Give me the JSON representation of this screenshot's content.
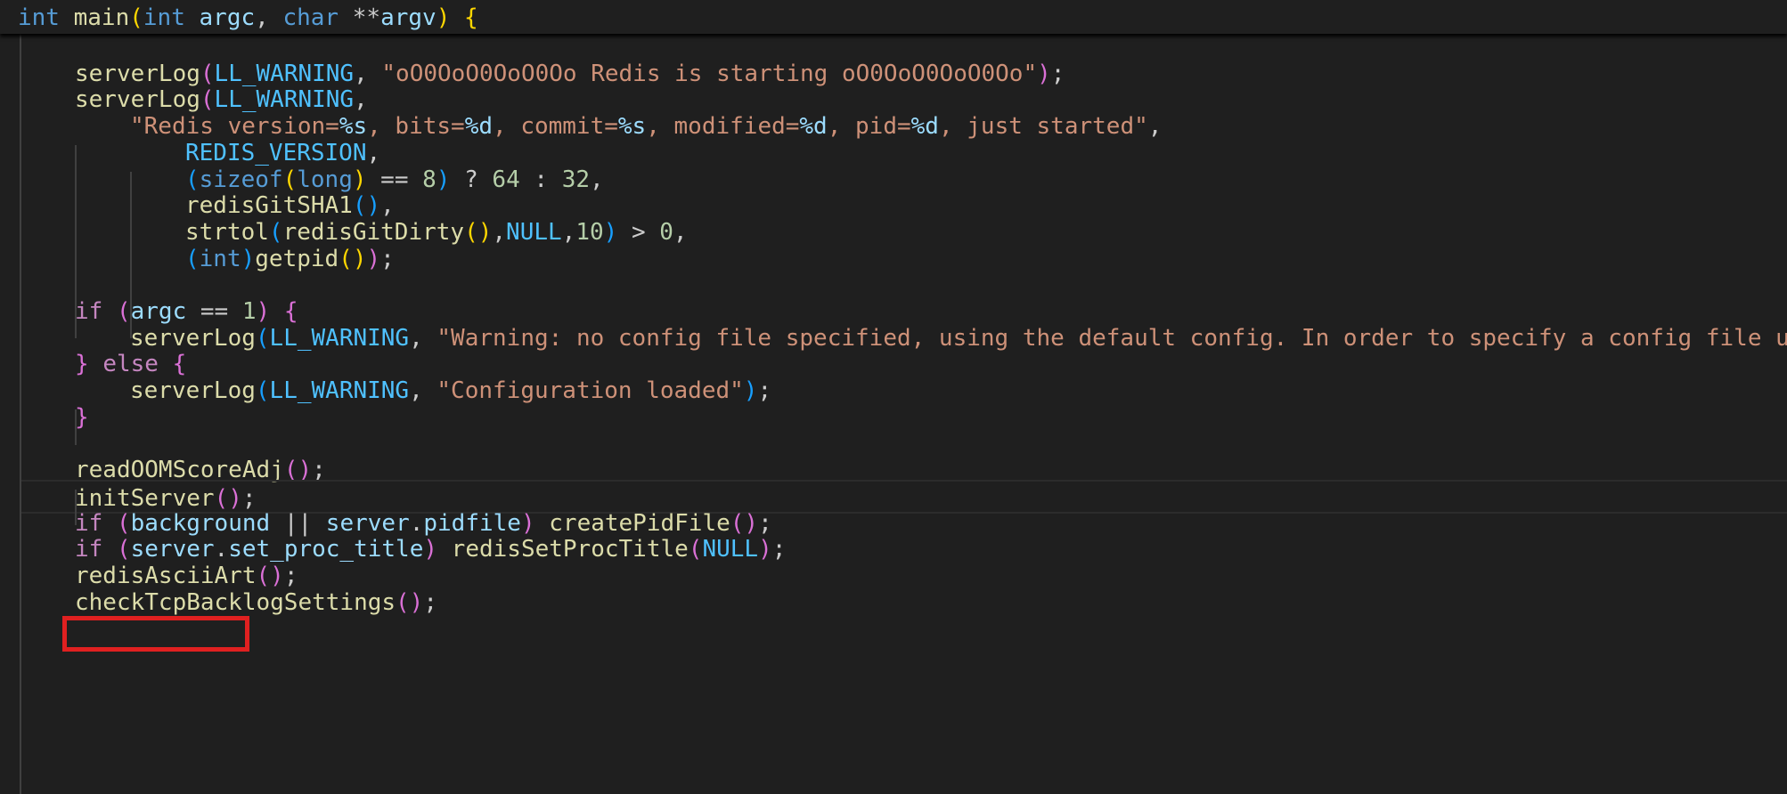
{
  "colors": {
    "background": "#1f1f1f",
    "keyword": "#569cd6",
    "control": "#c586c0",
    "function": "#dcdcaa",
    "variable": "#9cdcfe",
    "macro": "#4fc1ff",
    "string": "#ce9178",
    "number": "#b5cea8",
    "bracket_level_1": "#ffd700",
    "bracket_level_2": "#da70d6",
    "bracket_level_3": "#179fff",
    "highlight_box": "#e02020"
  },
  "sticky_header": [
    [
      "k",
      "int"
    ],
    [
      "p",
      " "
    ],
    [
      "f",
      "main"
    ],
    [
      "b1",
      "("
    ],
    [
      "k",
      "int"
    ],
    [
      "p",
      " "
    ],
    [
      "v",
      "argc"
    ],
    [
      "p",
      ", "
    ],
    [
      "k",
      "char"
    ],
    [
      "p",
      " **"
    ],
    [
      "v",
      "argv"
    ],
    [
      "b1",
      ")"
    ],
    [
      "p",
      " "
    ],
    [
      "b1",
      "{"
    ]
  ],
  "lines": [
    [],
    [
      [
        "f",
        "serverLog"
      ],
      [
        "b2",
        "("
      ],
      [
        "m",
        "LL_WARNING"
      ],
      [
        "p",
        ", "
      ],
      [
        "s",
        "\"oO0OoO0OoO0Oo Redis is starting oO0OoO0OoO0Oo\""
      ],
      [
        "b2",
        ")"
      ],
      [
        "p",
        ";"
      ]
    ],
    [
      [
        "f",
        "serverLog"
      ],
      [
        "b2",
        "("
      ],
      [
        "m",
        "LL_WARNING"
      ],
      [
        "p",
        ","
      ]
    ],
    [
      [
        "s",
        "\"Redis version="
      ],
      [
        "fm",
        "%s"
      ],
      [
        "s",
        ", bits="
      ],
      [
        "fm",
        "%d"
      ],
      [
        "s",
        ", commit="
      ],
      [
        "fm",
        "%s"
      ],
      [
        "s",
        ", modified="
      ],
      [
        "fm",
        "%d"
      ],
      [
        "s",
        ", pid="
      ],
      [
        "fm",
        "%d"
      ],
      [
        "s",
        ", just started\""
      ],
      [
        "p",
        ","
      ]
    ],
    [
      [
        "m",
        "REDIS_VERSION"
      ],
      [
        "p",
        ","
      ]
    ],
    [
      [
        "b3",
        "("
      ],
      [
        "k",
        "sizeof"
      ],
      [
        "b1",
        "("
      ],
      [
        "k",
        "long"
      ],
      [
        "b1",
        ")"
      ],
      [
        "p",
        " == "
      ],
      [
        "n",
        "8"
      ],
      [
        "b3",
        ")"
      ],
      [
        "p",
        " ? "
      ],
      [
        "n",
        "64"
      ],
      [
        "p",
        " : "
      ],
      [
        "n",
        "32"
      ],
      [
        "p",
        ","
      ]
    ],
    [
      [
        "f",
        "redisGitSHA1"
      ],
      [
        "b3",
        "()"
      ],
      [
        "p",
        ","
      ]
    ],
    [
      [
        "f",
        "strtol"
      ],
      [
        "b3",
        "("
      ],
      [
        "f",
        "redisGitDirty"
      ],
      [
        "b1",
        "()"
      ],
      [
        "p",
        ","
      ],
      [
        "m",
        "NULL"
      ],
      [
        "p",
        ","
      ],
      [
        "n",
        "10"
      ],
      [
        "b3",
        ")"
      ],
      [
        "p",
        " > "
      ],
      [
        "n",
        "0"
      ],
      [
        "p",
        ","
      ]
    ],
    [
      [
        "b3",
        "("
      ],
      [
        "k",
        "int"
      ],
      [
        "b3",
        ")"
      ],
      [
        "f",
        "getpid"
      ],
      [
        "b1",
        "()"
      ],
      [
        "b2",
        ")"
      ],
      [
        "p",
        ";"
      ]
    ],
    [],
    [
      [
        "c",
        "if"
      ],
      [
        "p",
        " "
      ],
      [
        "b2",
        "("
      ],
      [
        "v",
        "argc"
      ],
      [
        "p",
        " == "
      ],
      [
        "n",
        "1"
      ],
      [
        "b2",
        ")"
      ],
      [
        "p",
        " "
      ],
      [
        "b2",
        "{"
      ]
    ],
    [
      [
        "f",
        "serverLog"
      ],
      [
        "b3",
        "("
      ],
      [
        "m",
        "LL_WARNING"
      ],
      [
        "p",
        ", "
      ],
      [
        "s",
        "\"Warning: no config file specified, using the default config. In order to specify a config file use"
      ]
    ],
    [
      [
        "b2",
        "}"
      ],
      [
        "p",
        " "
      ],
      [
        "c",
        "else"
      ],
      [
        "p",
        " "
      ],
      [
        "b2",
        "{"
      ]
    ],
    [
      [
        "f",
        "serverLog"
      ],
      [
        "b3",
        "("
      ],
      [
        "m",
        "LL_WARNING"
      ],
      [
        "p",
        ", "
      ],
      [
        "s",
        "\"Configuration loaded\""
      ],
      [
        "b3",
        ")"
      ],
      [
        "p",
        ";"
      ]
    ],
    [
      [
        "b2",
        "}"
      ]
    ],
    [],
    [
      [
        "f",
        "readOOMScoreAdj"
      ],
      [
        "b2",
        "()"
      ],
      [
        "p",
        ";"
      ]
    ],
    [
      [
        "f",
        "initServer"
      ],
      [
        "b2",
        "()"
      ],
      [
        "p",
        ";"
      ]
    ],
    [
      [
        "c",
        "if"
      ],
      [
        "p",
        " "
      ],
      [
        "b2",
        "("
      ],
      [
        "v",
        "background"
      ],
      [
        "p",
        " || "
      ],
      [
        "v",
        "server"
      ],
      [
        "p",
        "."
      ],
      [
        "v",
        "pidfile"
      ],
      [
        "b2",
        ")"
      ],
      [
        "p",
        " "
      ],
      [
        "f",
        "createPidFile"
      ],
      [
        "b2",
        "()"
      ],
      [
        "p",
        ";"
      ]
    ],
    [
      [
        "c",
        "if"
      ],
      [
        "p",
        " "
      ],
      [
        "b2",
        "("
      ],
      [
        "v",
        "server"
      ],
      [
        "p",
        "."
      ],
      [
        "v",
        "set_proc_title"
      ],
      [
        "b2",
        ")"
      ],
      [
        "p",
        " "
      ],
      [
        "f",
        "redisSetProcTitle"
      ],
      [
        "b2",
        "("
      ],
      [
        "m",
        "NULL"
      ],
      [
        "b2",
        ")"
      ],
      [
        "p",
        ";"
      ]
    ],
    [
      [
        "f",
        "redisAsciiArt"
      ],
      [
        "b2",
        "()"
      ],
      [
        "p",
        ";"
      ]
    ],
    [
      [
        "f",
        "checkTcpBacklogSettings"
      ],
      [
        "b2",
        "()"
      ],
      [
        "p",
        ";"
      ]
    ]
  ]
}
